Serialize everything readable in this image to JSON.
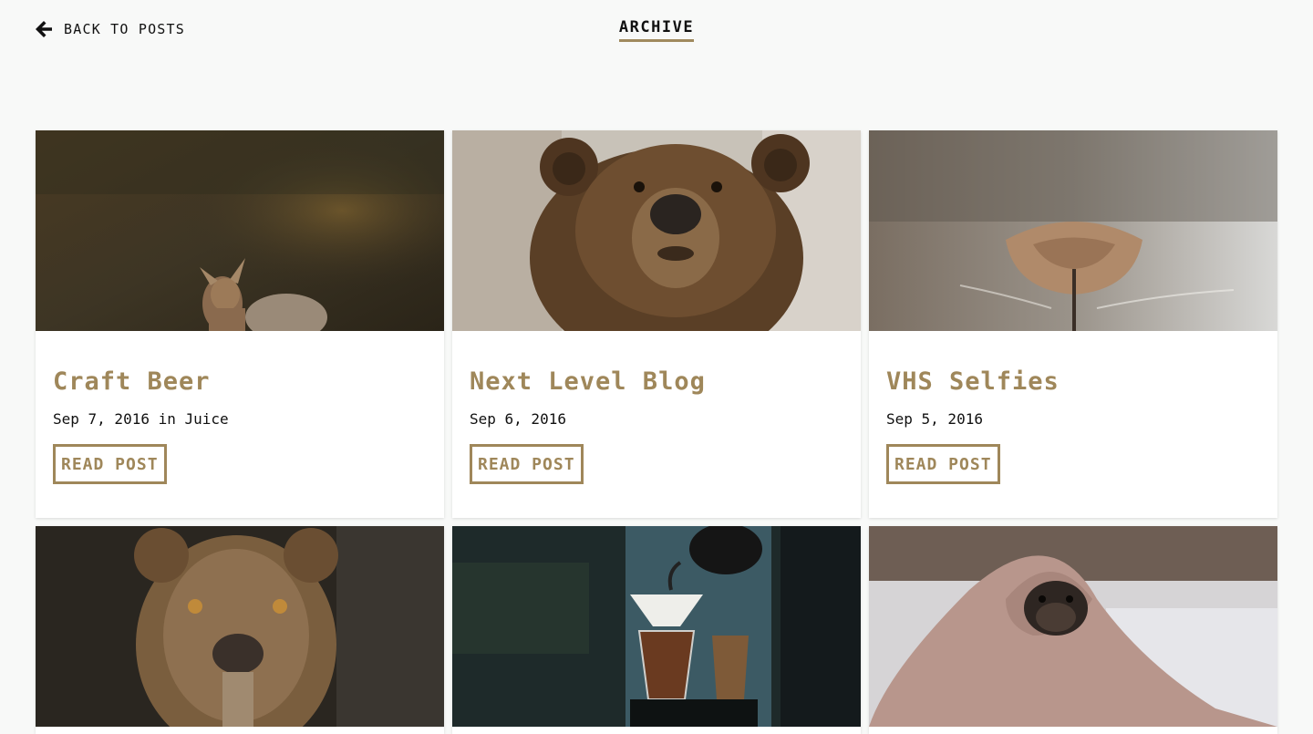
{
  "header": {
    "back_label": "BACK TO POSTS",
    "page_title": "ARCHIVE"
  },
  "colors": {
    "accent": "#9f875a",
    "background": "#f8f9f8",
    "text": "#111111"
  },
  "posts": [
    {
      "title": "Craft Beer",
      "meta": "Sep 7, 2016 in Juice",
      "button": "READ POST",
      "image": "deer-photo"
    },
    {
      "title": "Next Level Blog",
      "meta": "Sep 6, 2016",
      "button": "READ POST",
      "image": "bear-photo"
    },
    {
      "title": "VHS Selfies",
      "meta": "Sep 5, 2016",
      "button": "READ POST",
      "image": "cat-nose-photo"
    },
    {
      "image": "lioness-photo"
    },
    {
      "image": "coffee-pourover-photo"
    },
    {
      "image": "pug-blanket-photo"
    }
  ]
}
